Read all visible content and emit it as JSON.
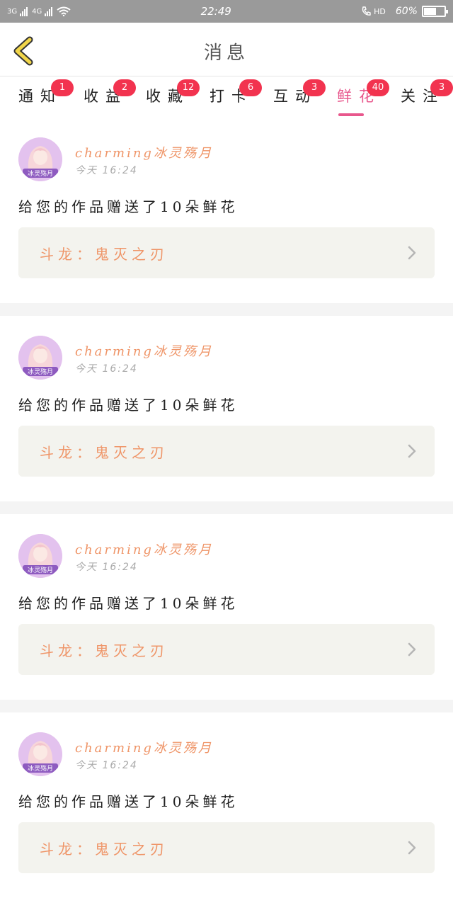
{
  "status_bar": {
    "left_net1": "3G",
    "left_net2": "4G",
    "time": "22:49",
    "hd": "HD",
    "battery_percent_label": "60%",
    "battery_level": 0.6
  },
  "header": {
    "title": "消息"
  },
  "tabs": [
    {
      "label": "通知",
      "badge": "1"
    },
    {
      "label": "收益",
      "badge": "2"
    },
    {
      "label": "收藏",
      "badge": "12"
    },
    {
      "label": "打卡",
      "badge": "6"
    },
    {
      "label": "互动",
      "badge": "3"
    },
    {
      "label": "鲜花",
      "badge": "40",
      "active": true
    },
    {
      "label": "关注",
      "badge": "3"
    }
  ],
  "messages": [
    {
      "username": "charming冰灵殇月",
      "time": "今天 16:24",
      "text": "给您的作品赠送了10朵鲜花",
      "work_title": "斗龙：鬼灭之刃"
    },
    {
      "username": "charming冰灵殇月",
      "time": "今天 16:24",
      "text": "给您的作品赠送了10朵鲜花",
      "work_title": "斗龙：鬼灭之刃"
    },
    {
      "username": "charming冰灵殇月",
      "time": "今天 16:24",
      "text": "给您的作品赠送了10朵鲜花",
      "work_title": "斗龙：鬼灭之刃"
    },
    {
      "username": "charming冰灵殇月",
      "time": "今天 16:24",
      "text": "给您的作品赠送了10朵鲜花",
      "work_title": "斗龙：鬼灭之刃"
    }
  ],
  "avatar_text": "冰灵殇月",
  "colors": {
    "accent_pink": "#e8578c",
    "badge_red": "#f2334f",
    "link_orange": "#ef9568",
    "back_yellow": "#f2d64a"
  }
}
